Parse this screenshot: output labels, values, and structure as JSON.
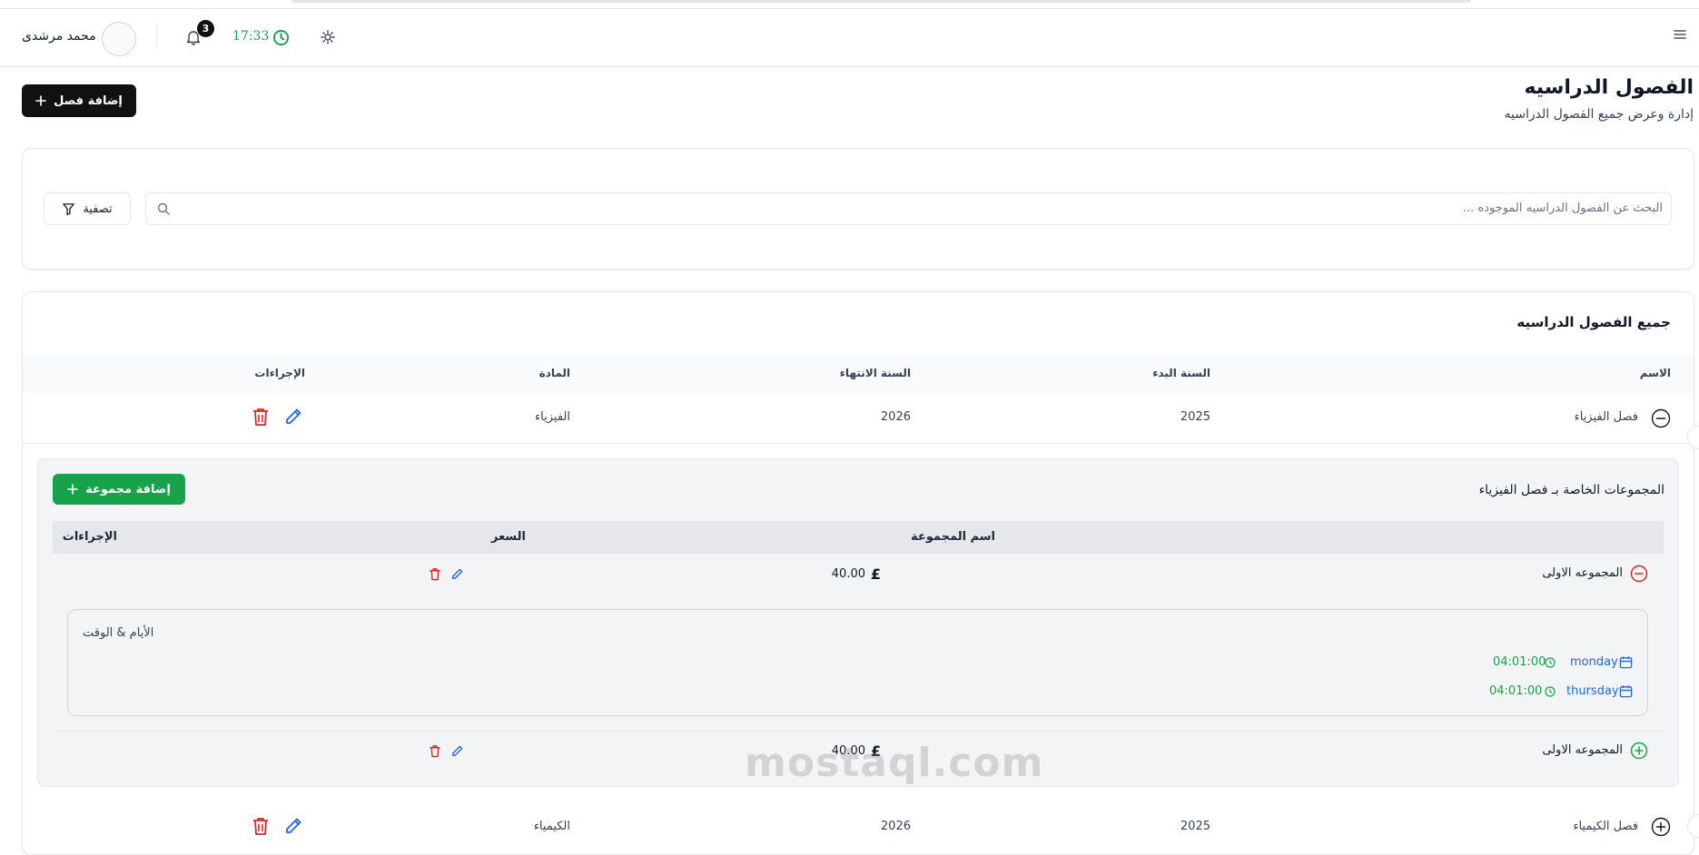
{
  "header": {
    "user_name": "محمد مرشدى",
    "notifications_count": "3",
    "time": "17:33"
  },
  "page": {
    "title": "الفصول الدراسيه",
    "subtitle": "إدارة وعرض جميع الفصول الدراسيه",
    "add_class_label": "إضافة فصل"
  },
  "search": {
    "placeholder": "البحث عن الفصول الدراسيه الموجوده ...",
    "filter_label": "تصفية"
  },
  "table": {
    "title": "جميع الفصول الدراسيه",
    "columns": {
      "name": "الاسم",
      "start_year": "السنة البدء",
      "end_year": "السنة الانتهاء",
      "subject": "المادة",
      "actions": "الإجراءات"
    },
    "rows": [
      {
        "name": "فصل الفيزياء",
        "start_year": "2025",
        "end_year": "2026",
        "subject": "الفيزياء"
      },
      {
        "name": "فصل الكيمياء",
        "start_year": "2025",
        "end_year": "2026",
        "subject": "الكيمياء"
      }
    ]
  },
  "groups": {
    "title": "المجموعات الخاصة بـ فصل الفيزياء",
    "add_group_label": "إضافة مجموعة",
    "columns": {
      "name": "اسم المجموعة",
      "price": "السعر",
      "actions": "الإجراءات"
    },
    "rows": [
      {
        "name": "المجموعه الاولى",
        "price": "40.00",
        "currency": "£"
      },
      {
        "name": "المجموعه الاولى",
        "price": "40.00",
        "currency": "£"
      }
    ],
    "schedule": {
      "title": "الأيام & الوقت",
      "items": [
        {
          "day": "monday",
          "time": "04:01:00"
        },
        {
          "day": "thursday",
          "time": "04:01:00"
        }
      ]
    }
  },
  "watermark": "mostaql.com",
  "colors": {
    "accent_green": "#16a34a",
    "danger_red": "#dc2626",
    "link_blue": "#2563eb",
    "primary_dark": "#111111"
  }
}
